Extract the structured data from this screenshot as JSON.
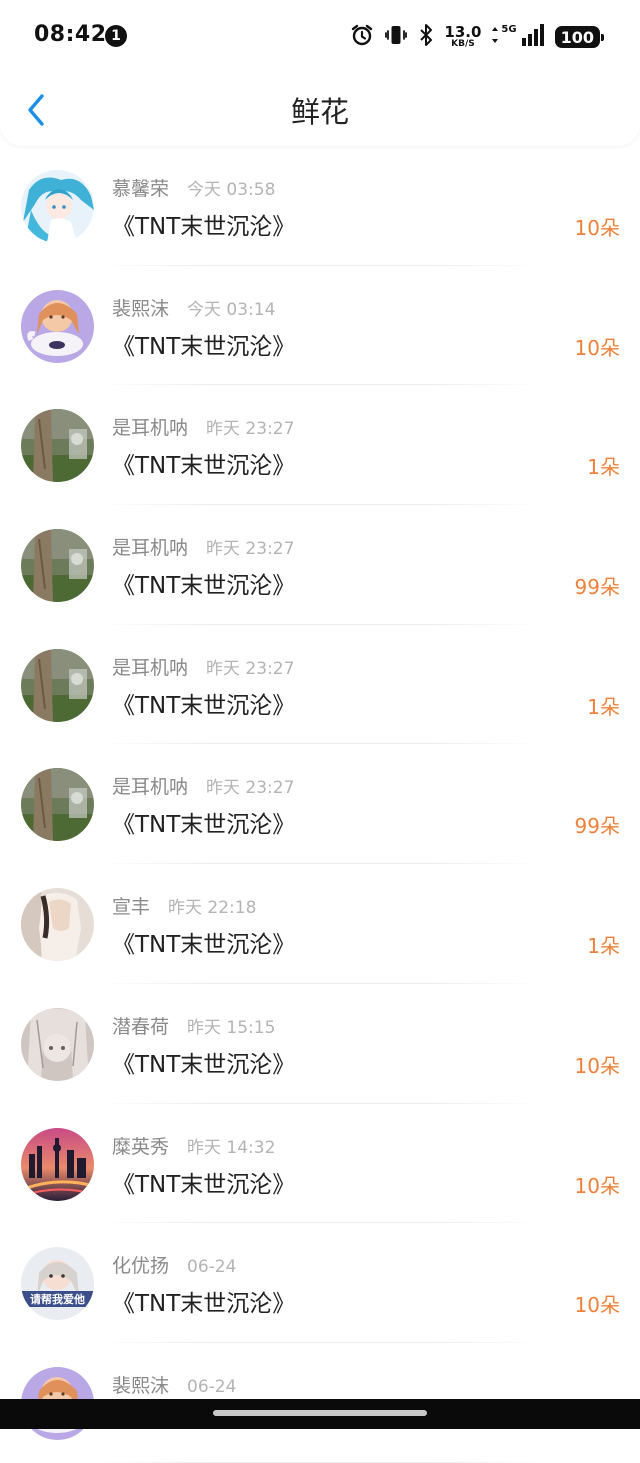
{
  "status": {
    "time": "08:42",
    "notification_count": "1",
    "net_speed_value": "13.0",
    "net_speed_unit": "KB/S",
    "network": "5G",
    "battery": "100"
  },
  "header": {
    "title": "鲜花"
  },
  "items": [
    {
      "name": "慕馨荣",
      "time": "今天 03:58",
      "book": "《TNT末世沉沦》",
      "count": "10朵",
      "avatar": "anime-girl-blue-hair"
    },
    {
      "name": "裴熙沫",
      "time": "今天 03:14",
      "book": "《TNT末世沉沦》",
      "count": "10朵",
      "avatar": "girl-with-plush"
    },
    {
      "name": "是耳机呐",
      "time": "昨天 23:27",
      "book": "《TNT末世沉沦》",
      "count": "1朵",
      "avatar": "tree-trunk-photo"
    },
    {
      "name": "是耳机呐",
      "time": "昨天 23:27",
      "book": "《TNT末世沉沦》",
      "count": "99朵",
      "avatar": "tree-trunk-photo"
    },
    {
      "name": "是耳机呐",
      "time": "昨天 23:27",
      "book": "《TNT末世沉沦》",
      "count": "1朵",
      "avatar": "tree-trunk-photo"
    },
    {
      "name": "是耳机呐",
      "time": "昨天 23:27",
      "book": "《TNT末世沉沦》",
      "count": "99朵",
      "avatar": "tree-trunk-photo"
    },
    {
      "name": "宣丰",
      "time": "昨天 22:18",
      "book": "《TNT末世沉沦》",
      "count": "1朵",
      "avatar": "woman-back-photo"
    },
    {
      "name": "潜春荷",
      "time": "昨天 15:15",
      "book": "《TNT末世沉沦》",
      "count": "10朵",
      "avatar": "sketch-girl"
    },
    {
      "name": "糜英秀",
      "time": "昨天 14:32",
      "book": "《TNT末世沉沦》",
      "count": "10朵",
      "avatar": "city-night-skyline"
    },
    {
      "name": "化优扬",
      "time": "06-24",
      "book": "《TNT末世沉沦》",
      "count": "10朵",
      "avatar": "girl-with-caption"
    },
    {
      "name": "裴熙沫",
      "time": "06-24",
      "book": "",
      "count": "",
      "avatar": "girl-with-plush"
    }
  ],
  "avatar_caption": "请帮我爱他",
  "colors": {
    "accent_blue": "#1e8fe8",
    "count_orange": "#f0813a",
    "name_gray": "#8a8a8a",
    "time_gray": "#b4b4b4"
  }
}
